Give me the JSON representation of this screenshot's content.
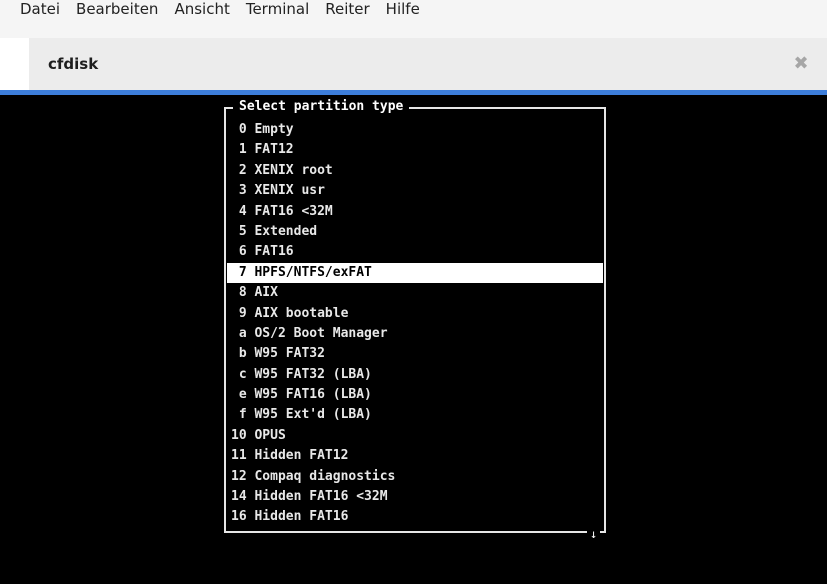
{
  "menubar": {
    "items": [
      "Datei",
      "Bearbeiten",
      "Ansicht",
      "Terminal",
      "Reiter",
      "Hilfe"
    ]
  },
  "tab": {
    "title": "cfdisk",
    "close_icon": "close-icon"
  },
  "colors": {
    "accent": "#3d7edb",
    "terminal_bg": "#000000",
    "text": "#e8e8e8",
    "selection_bg": "#ffffff"
  },
  "dialog": {
    "title": "Select partition type",
    "scroll_indicator": "↓",
    "selected_index": 7,
    "types": [
      " 0 Empty",
      " 1 FAT12",
      " 2 XENIX root",
      " 3 XENIX usr",
      " 4 FAT16 <32M",
      " 5 Extended",
      " 6 FAT16",
      " 7 HPFS/NTFS/exFAT",
      " 8 AIX",
      " 9 AIX bootable",
      " a OS/2 Boot Manager",
      " b W95 FAT32",
      " c W95 FAT32 (LBA)",
      " e W95 FAT16 (LBA)",
      " f W95 Ext'd (LBA)",
      "10 OPUS",
      "11 Hidden FAT12",
      "12 Compaq diagnostics",
      "14 Hidden FAT16 <32M",
      "16 Hidden FAT16"
    ]
  }
}
